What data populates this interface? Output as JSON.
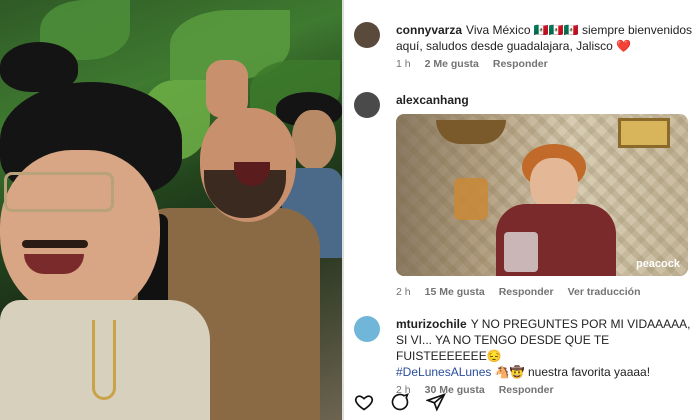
{
  "comments": [
    {
      "username": "connyvarza",
      "text": "Viva México 🇲🇽🇲🇽🇲🇽 siempre bienvenidos aquí, saludos desde guadalajara, Jalisco",
      "heart": "❤️",
      "time": "1 h",
      "likes": "2 Me gusta",
      "reply": "Responder",
      "avatar_color": "#5a4a3c"
    },
    {
      "username": "alexcanhang",
      "time": "2 h",
      "likes": "15 Me gusta",
      "reply": "Responder",
      "translation": "Ver traducción",
      "avatar_color": "#4a4a4a",
      "gif_watermark": "peacock"
    },
    {
      "username": "mturizochile",
      "text_1": "Y NO PREGUNTES POR MI VIDAAAAA, SI VI... YA NO TENGO DESDE QUE TE FUISTEEEEEEE😔",
      "hashtag": "#DeLunesALunes",
      "text_2": "🐴🤠 nuestra favorita yaaaa!",
      "time": "2 h",
      "likes": "30 Me gusta",
      "reply": "Responder",
      "avatar_color": "#6fb6d8"
    }
  ],
  "action_icons": [
    "heart-outline-icon",
    "comment-bubble-icon",
    "share-send-icon"
  ]
}
